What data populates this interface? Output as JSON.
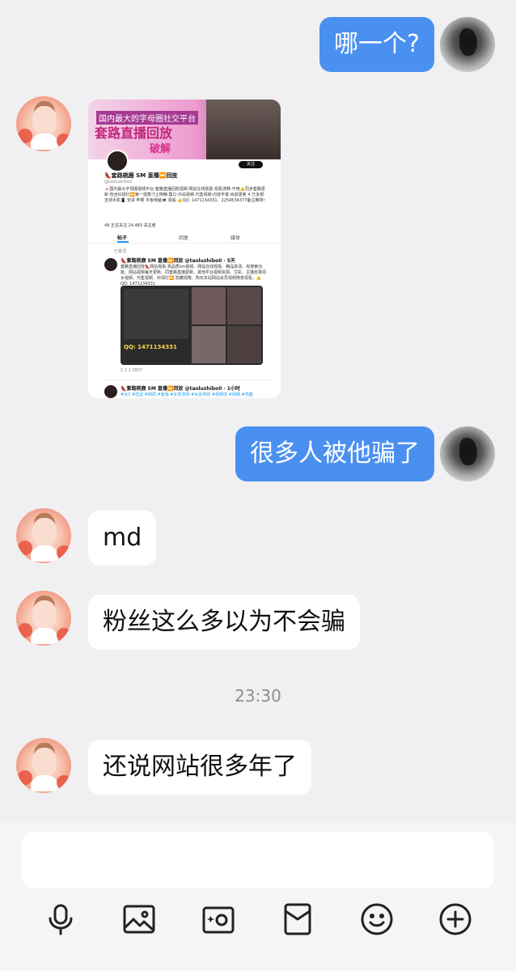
{
  "messages": [
    {
      "side": "me",
      "type": "text",
      "text": "哪一个?"
    },
    {
      "side": "other",
      "type": "image",
      "alt": "shared-profile-screenshot"
    },
    {
      "side": "me",
      "type": "text",
      "text": "很多人被他骗了"
    },
    {
      "side": "other",
      "type": "text",
      "text": "md"
    },
    {
      "side": "other",
      "type": "text",
      "text": "粉丝这么多以为不会骗"
    },
    {
      "side": "other",
      "type": "text",
      "text": "还说网站很多年了"
    }
  ],
  "timestamp": "23:30",
  "shared_image": {
    "banner_line1": "国内最大的字母圈社交平台",
    "banner_line2": "套路直播回放",
    "banner_line3": "破解",
    "follow_label": "关注",
    "profile_name": "👠套路桃鹿 SM 直播⏩回放",
    "handle": "@taoluzhibo0",
    "bio": "🔺国内最大字母圈视频平台·套路直播回放视频·网站在线观看·观看流畅·不用👍同步套路更新·包含红绿灯⏩第一视角寸止榨精·露口·外站视频·代售视频·内容丰富·目前更新 4 万多部·支持手机📱 安卓 苹果 平板电脑💻 观看 👍QQ: 1471134331、2254534377备注推特!",
    "stats": "49 正在关注   24,483 关注者",
    "tabs": [
      "帖子",
      "回复",
      "媒体"
    ],
    "pinned": "已置顶",
    "post_title": "👠套路桃鹿 SM 直播⏩回放 @taoluzhibo0 · 5天",
    "post_text": "套路直播回放👠网站观看 高品质sm视频、网站在线观看、精品高清、有搜索功能、网站视频每天更新、同套路直播更新、其他平台视频资源、艾彩、主播自录闺女视频、代售视频、红绿灯⏩ 隐藏视角、购买本站网站会员视频随意观看。👍QQ: 1471134331",
    "qq_text": "QQ: 1471134331",
    "actions": "2    1    1    3807",
    "post2_title": "👠套路桃鹿 SM 直播⏩回放 @taoluzhibo0 · 1小时",
    "post2_tags": "#女S #恋足 #网调 #羞辱 #女性崇拜 #女喜男奴 #视频控 #绿帽 #洗脑"
  },
  "composer": {
    "placeholder": ""
  },
  "toolbar": [
    "microphone-icon",
    "image-icon",
    "camera-icon",
    "red-packet-icon",
    "emoji-icon",
    "plus-icon"
  ],
  "colors": {
    "bubble_me": "#4a90f0",
    "bubble_other": "#ffffff",
    "background": "#f0f0f2"
  }
}
